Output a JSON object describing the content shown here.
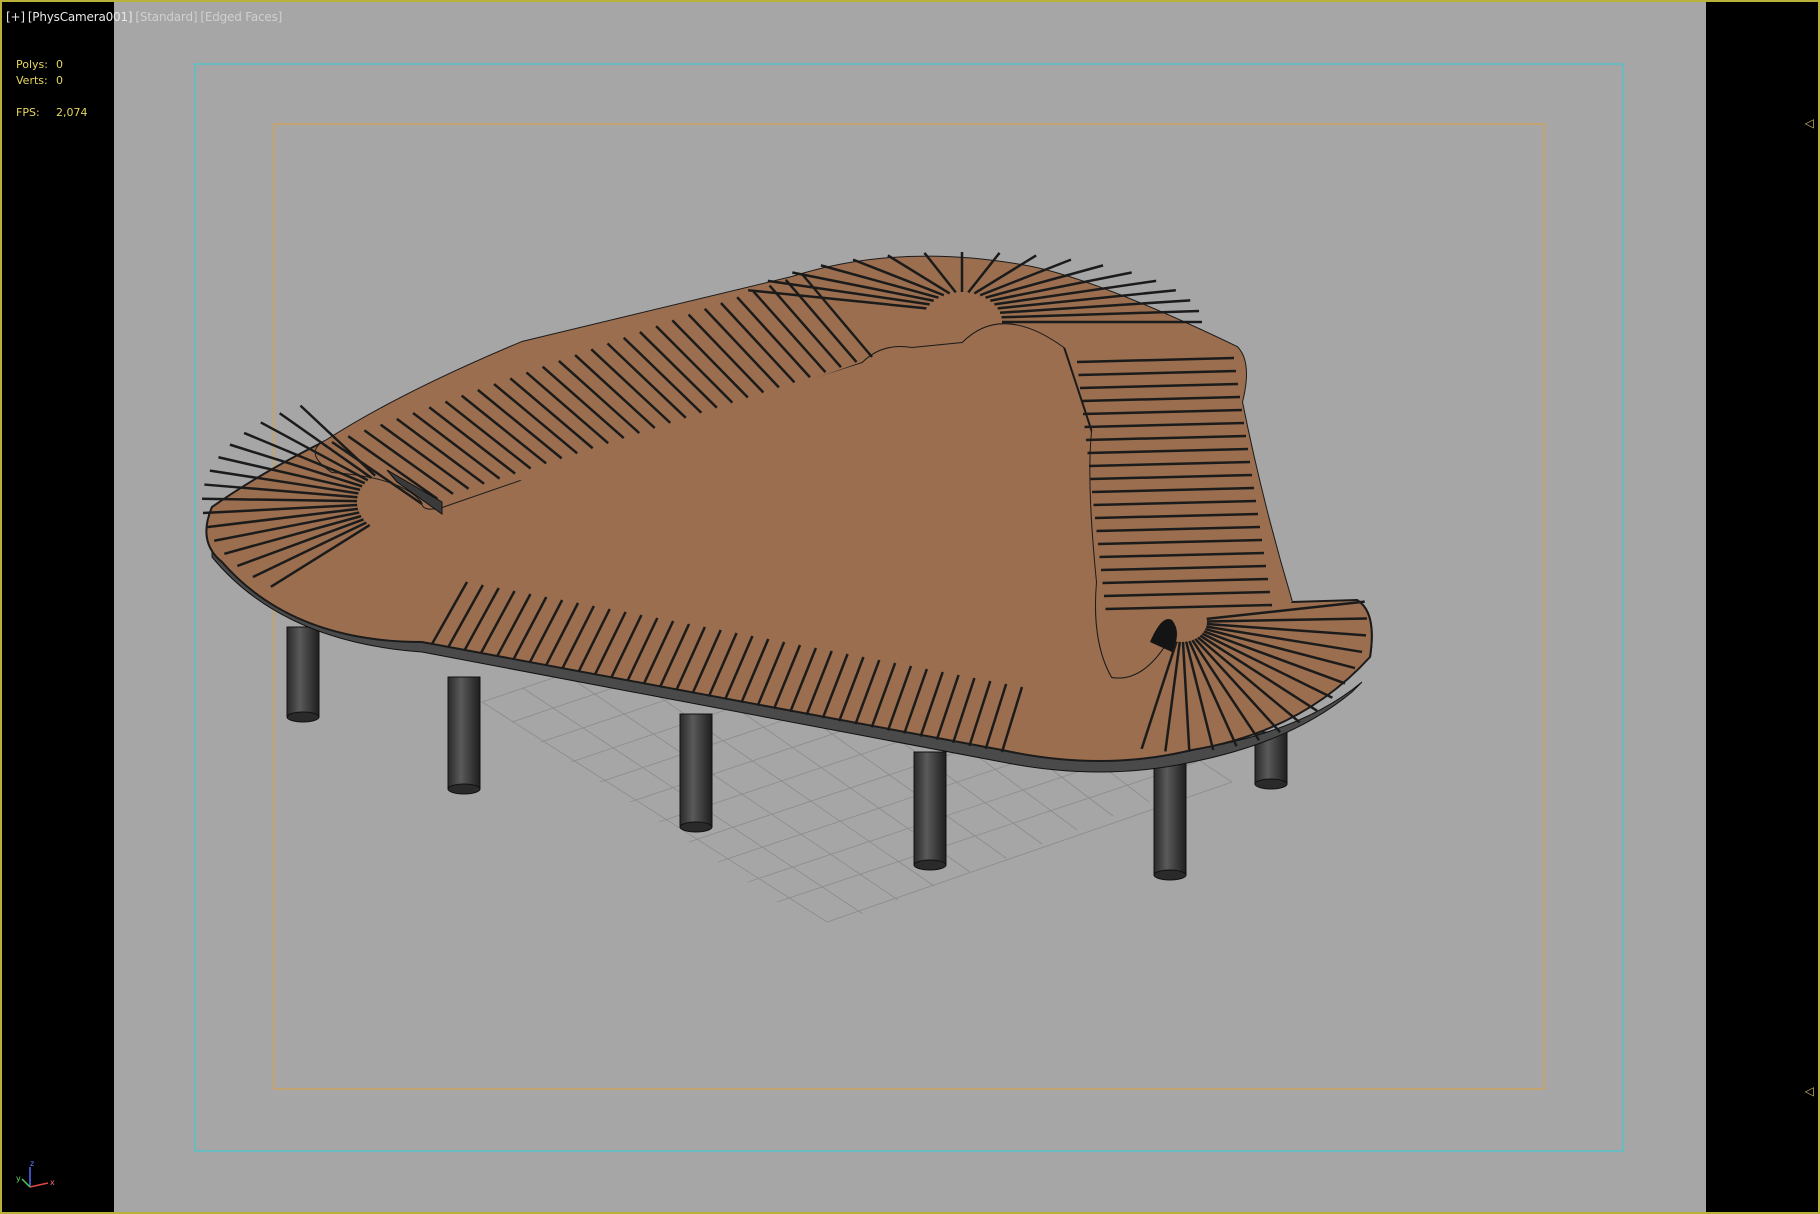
{
  "viewport": {
    "label_plus": "[+]",
    "label_camera": "[PhysCamera001]",
    "label_shading": "[Standard]",
    "label_mode": "[Edged Faces]"
  },
  "stats": {
    "polys_label": "Polys:",
    "polys_value": "0",
    "verts_label": "Verts:",
    "verts_value": "0",
    "fps_label": "FPS:",
    "fps_value": "2,074"
  },
  "axis_gizmo": {
    "x": "x",
    "y": "y",
    "z": "z"
  },
  "colors": {
    "frame_border": "#b9b13a",
    "viewport_bg": "#a6a6a6",
    "safe_frame_outer": "#2fd0d8",
    "safe_frame_inner": "#e0a23a",
    "wood": "#9a6e4e",
    "stats_text": "#e6d75a"
  }
}
